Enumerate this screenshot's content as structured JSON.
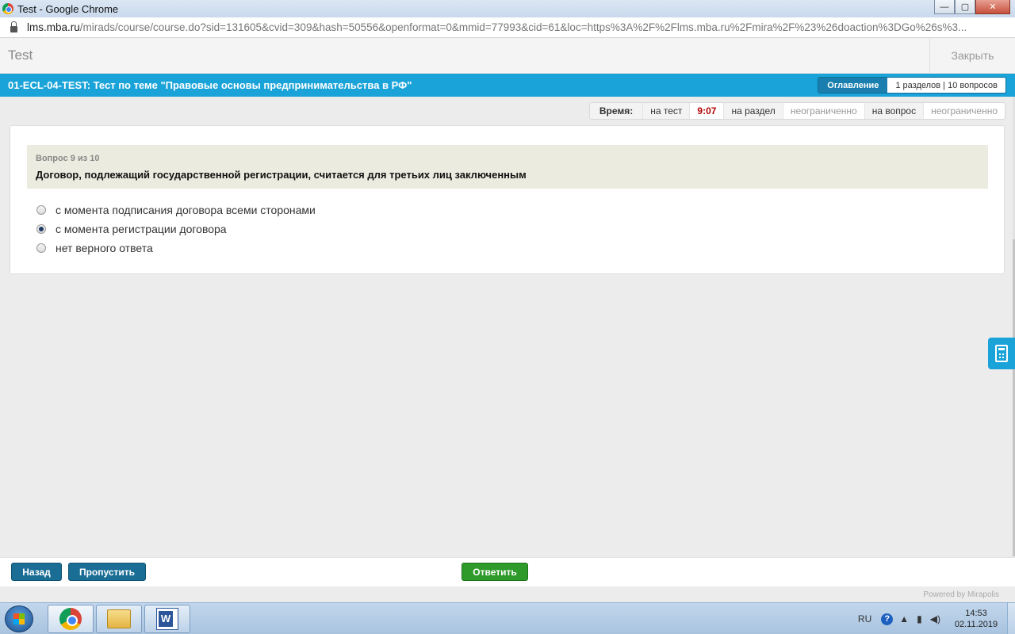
{
  "window": {
    "title": "Test - Google Chrome",
    "min_label": "—",
    "max_label": "▢",
    "close_label": "✕"
  },
  "browser": {
    "url_host": "lms.mba.ru",
    "url_path": "/mirads/course/course.do?sid=131605&cvid=309&hash=50556&openformat=0&mmid=77993&cid=61&loc=https%3A%2F%2Flms.mba.ru%2Fmira%2F%23%26doaction%3DGo%26s%3..."
  },
  "header": {
    "title": "Test",
    "close_label": "Закрыть"
  },
  "test": {
    "title": "01-ECL-04-TEST: Тест по теме \"Правовые основы предпринимательства в РФ\"",
    "toc_label": "Оглавление",
    "toc_info": "1 разделов | 10 вопросов"
  },
  "timer": {
    "label": "Время:",
    "test_key": "на тест",
    "test_value": "9:07",
    "section_key": "на раздел",
    "section_value": "неограниченно",
    "question_key": "на вопрос",
    "question_value": "неограниченно"
  },
  "question": {
    "number": "Вопрос 9 из 10",
    "text": "Договор, подлежащий государственной регистрации, считается для третьих лиц заключенным",
    "options": [
      {
        "label": "с момента подписания договора всеми сторонами",
        "selected": false
      },
      {
        "label": "с момента регистрации договора",
        "selected": true
      },
      {
        "label": "нет верного ответа",
        "selected": false
      }
    ]
  },
  "nav": {
    "back_label": "Назад",
    "skip_label": "Пропустить",
    "answer_label": "Ответить"
  },
  "footer": {
    "powered": "Powered by Mirapolis"
  },
  "taskbar": {
    "lang": "RU",
    "help": "?",
    "time": "14:53",
    "date": "02.11.2019"
  },
  "colors": {
    "accent": "#1aa3d8",
    "nav_button": "#1a6e96",
    "answer_button": "#2e9a2a",
    "timer_value": "#b00000"
  }
}
